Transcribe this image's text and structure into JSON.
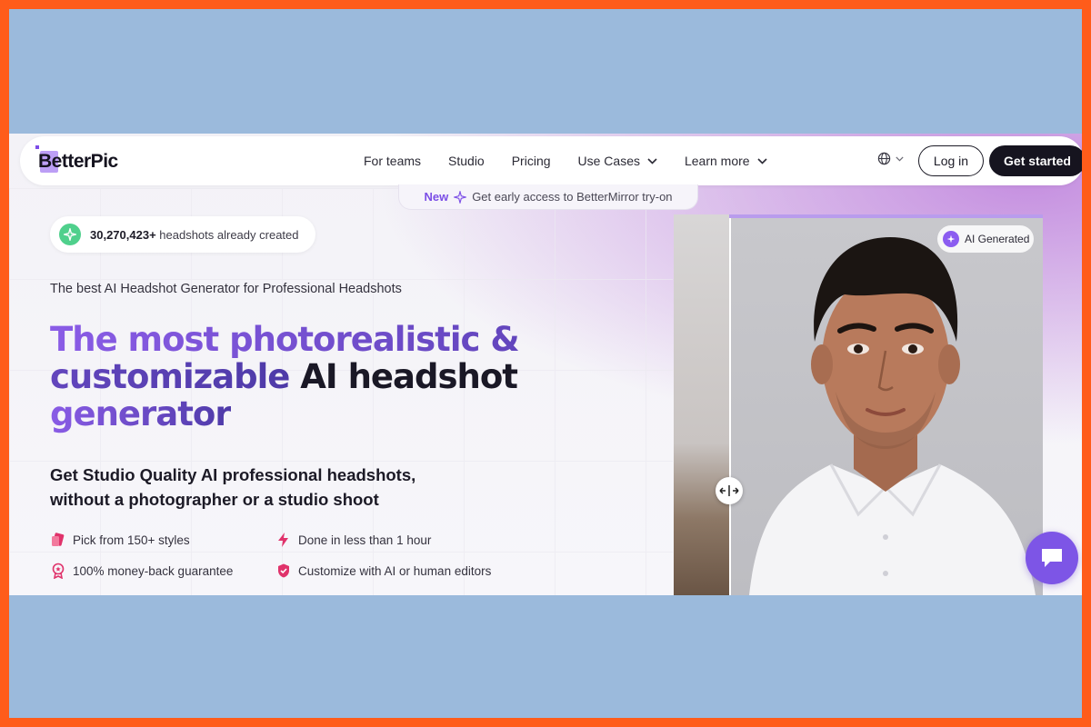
{
  "brand": {
    "name": "BetterPic"
  },
  "nav": {
    "links": [
      {
        "label": "For teams"
      },
      {
        "label": "Studio"
      },
      {
        "label": "Pricing"
      },
      {
        "label": "Use Cases"
      },
      {
        "label": "Learn more"
      }
    ],
    "login_label": "Log in",
    "cta_label": "Get started"
  },
  "banner": {
    "new_label": "New",
    "text": "Get early access to BetterMirror try-on"
  },
  "counter": {
    "count": "30,270,423+",
    "text": "headshots already created"
  },
  "hero": {
    "tagline": "The best AI Headshot Generator for Professional Headshots",
    "headline_accent": "The most photorealistic & customizable",
    "headline_rest": "AI headshot",
    "headline_end": "generator",
    "subheading_line1": "Get Studio Quality AI professional headshots,",
    "subheading_line2": "without a photographer or a studio shoot"
  },
  "features": [
    {
      "label": "Pick from 150+ styles",
      "icon": "tag-icon"
    },
    {
      "label": "Done in less than 1 hour",
      "icon": "lightning-icon"
    },
    {
      "label": "100% money-back guarantee",
      "icon": "badge-icon"
    },
    {
      "label": "Customize with AI or human editors",
      "icon": "shield-icon"
    }
  ],
  "photo": {
    "badge_label": "AI Generated"
  },
  "colors": {
    "accent": "#7b4ee6",
    "dark": "#16141f",
    "feature_icon": "#e0336b",
    "counter_icon": "#4fd08c",
    "outer_border": "#ff5c1a",
    "backdrop": "#9bbadc"
  }
}
